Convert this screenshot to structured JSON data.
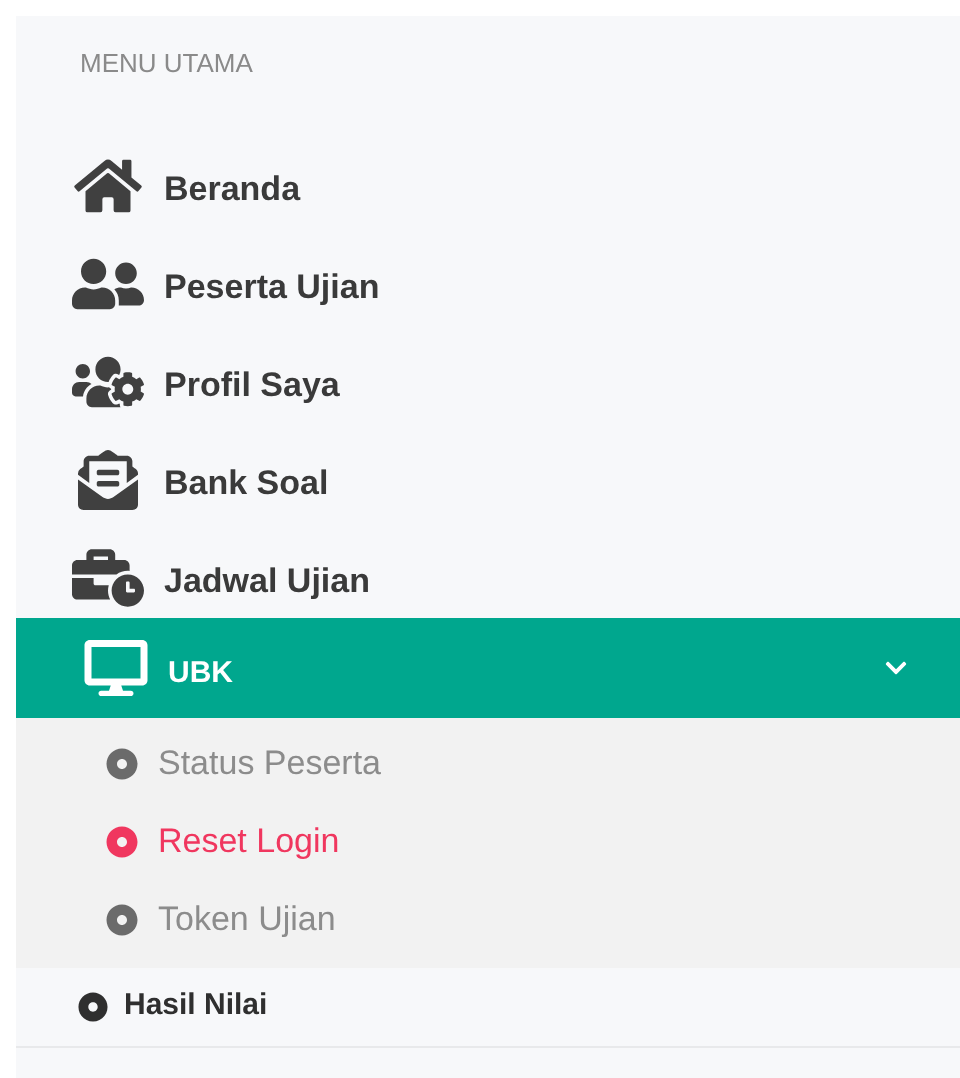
{
  "menu": {
    "heading": "MENU UTAMA",
    "items": [
      {
        "kind": "link",
        "label": "Beranda"
      },
      {
        "kind": "link",
        "label": "Peserta Ujian"
      },
      {
        "kind": "link",
        "label": "Profil Saya"
      },
      {
        "kind": "link",
        "label": "Bank Soal"
      },
      {
        "kind": "link",
        "label": "Jadwal Ujian"
      },
      {
        "kind": "group",
        "label": "UBK",
        "expanded": true,
        "children": [
          {
            "label": "Status Peserta",
            "selected": false
          },
          {
            "label": "Reset Login",
            "selected": true
          },
          {
            "label": "Token Ujian",
            "selected": false
          }
        ]
      },
      {
        "kind": "dot",
        "label": "Hasil Nilai"
      }
    ]
  }
}
